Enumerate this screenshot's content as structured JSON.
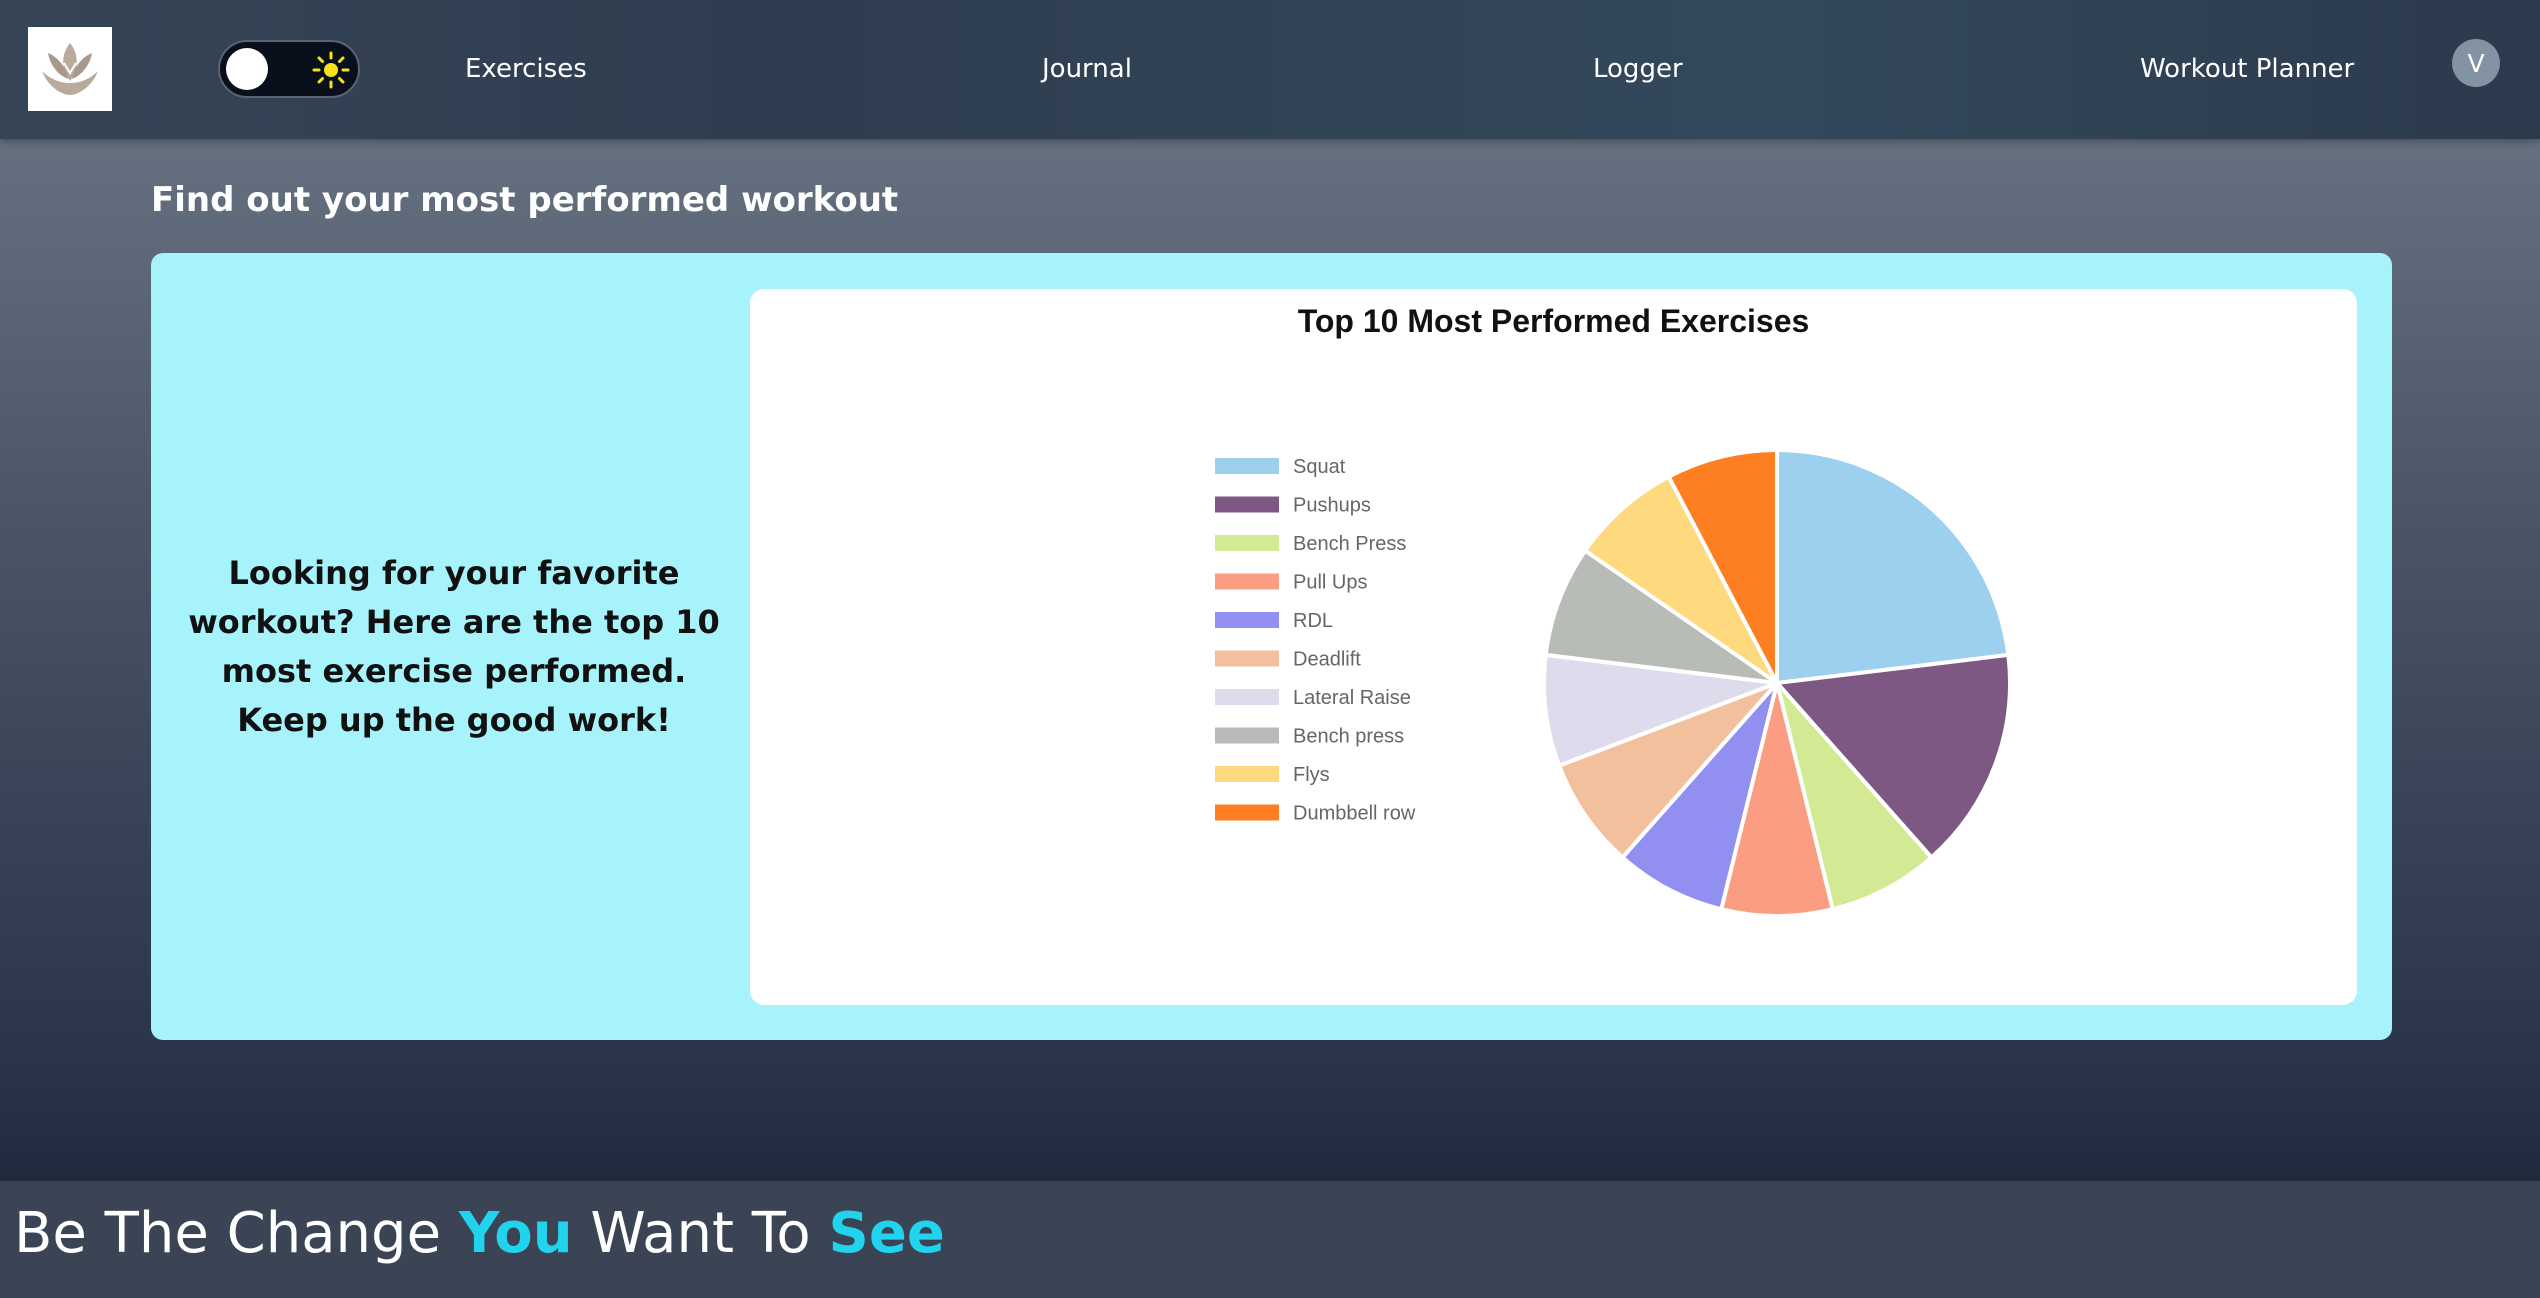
{
  "nav": {
    "links": [
      {
        "label": "Exercises"
      },
      {
        "label": "Journal"
      },
      {
        "label": "Logger"
      },
      {
        "label": "Workout Planner"
      }
    ],
    "avatar_initial": "V",
    "toggle_icon": "sun-icon",
    "logo_icon": "lotus-logo-icon"
  },
  "main": {
    "heading": "Find out your most performed workout",
    "blurb": "Looking for your favorite workout? Here are the top 10 most exercise performed. Keep up the good work!"
  },
  "chart_data": {
    "type": "pie",
    "title": "Top 10 Most Performed Exercises",
    "legend_position": "left",
    "categories": [
      "Squat",
      "Pushups",
      "Bench Press",
      "Pull Ups",
      "RDL",
      "Deadlift",
      "Lateral Raise",
      "Bench press",
      "Flys",
      "Dumbbell row"
    ],
    "values": [
      3,
      2,
      1,
      1,
      1,
      1,
      1,
      1,
      1,
      1
    ],
    "colors": [
      "#9dd0ef",
      "#7c5882",
      "#d3e993",
      "#fb9d83",
      "#9190f0",
      "#f2c09d",
      "#dddbec",
      "#b7bdb6",
      "#fed97d",
      "#fd7f22"
    ]
  },
  "footer": {
    "part1": "Be The Change ",
    "accent1": "You",
    "part2": " Want To ",
    "accent2": "See",
    "accent_color": "#22d3ee"
  }
}
